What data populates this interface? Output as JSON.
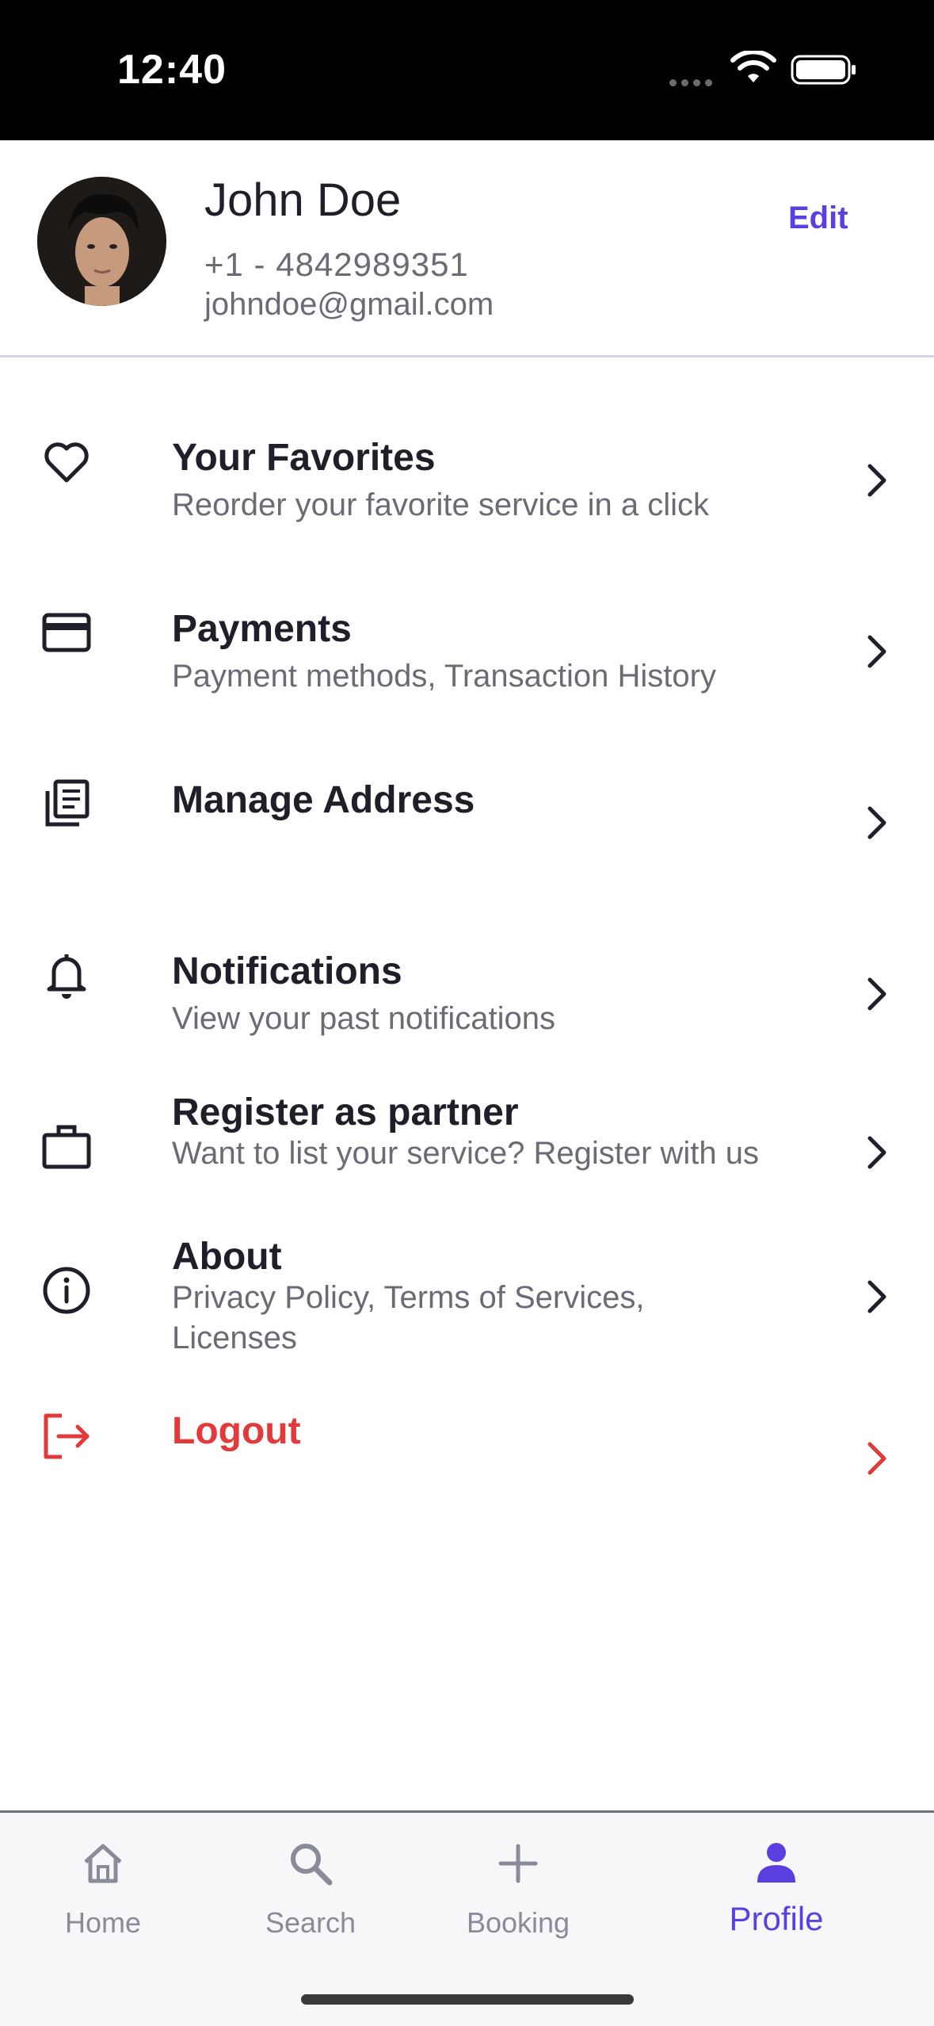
{
  "status_bar": {
    "time": "12:40"
  },
  "profile": {
    "name": "John Doe",
    "phone": "+1 - 4842989351",
    "email": "johndoe@gmail.com",
    "edit_label": "Edit"
  },
  "menu": [
    {
      "icon": "heart-icon",
      "title": "Your Favorites",
      "subtitle": "Reorder your favorite service in a click"
    },
    {
      "icon": "credit-card-icon",
      "title": "Payments",
      "subtitle": "Payment methods, Transaction History"
    },
    {
      "icon": "document-list-icon",
      "title": "Manage Address",
      "subtitle": ""
    },
    {
      "icon": "bell-icon",
      "title": "Notifications",
      "subtitle": "View your past notifications"
    },
    {
      "icon": "briefcase-icon",
      "title": "Register as partner",
      "subtitle": "Want to list your service? Register with us"
    },
    {
      "icon": "info-icon",
      "title": "About",
      "subtitle": "Privacy Policy, Terms of Services, Licenses"
    },
    {
      "icon": "logout-icon",
      "title": "Logout",
      "subtitle": ""
    }
  ],
  "tabs": [
    {
      "icon": "home-icon",
      "label": "Home",
      "active": false
    },
    {
      "icon": "search-icon",
      "label": "Search",
      "active": false
    },
    {
      "icon": "plus-icon",
      "label": "Booking",
      "active": false
    },
    {
      "icon": "person-icon",
      "label": "Profile",
      "active": true
    }
  ],
  "colors": {
    "accent": "#5b3fe0",
    "danger": "#e23a3a",
    "text": "#1f1f29",
    "muted": "#6b6b75"
  }
}
